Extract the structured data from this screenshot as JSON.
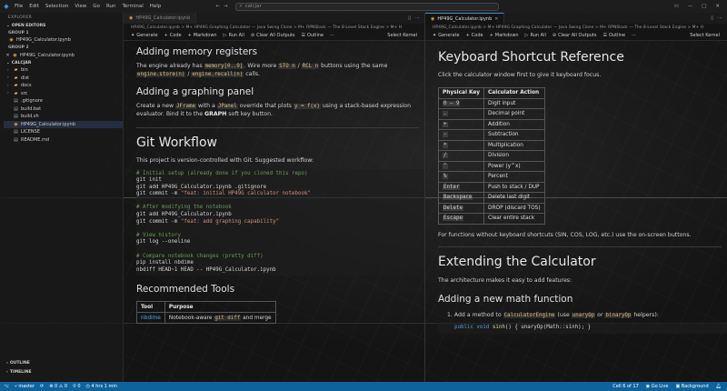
{
  "titlebar": {
    "menu": [
      "File",
      "Edit",
      "Selection",
      "View",
      "Go",
      "Run",
      "Terminal",
      "Help"
    ],
    "search_placeholder": "calcjar"
  },
  "sidebar": {
    "title": "EXPLORER",
    "open_editors": "OPEN EDITORS",
    "group1": "GROUP 1",
    "group1_items": [
      {
        "label": "HP49G_Calculator.ipynb"
      }
    ],
    "group2": "GROUP 2",
    "group2_items": [
      {
        "label": "HP49G_Calculator.ipynb"
      }
    ],
    "project": "CALCJAR",
    "tree": [
      {
        "label": "bin",
        "type": "folder"
      },
      {
        "label": "dist",
        "type": "folder"
      },
      {
        "label": "docs",
        "type": "folder"
      },
      {
        "label": "src",
        "type": "folder"
      },
      {
        "label": ".gitignore",
        "type": "file"
      },
      {
        "label": "build.bat",
        "type": "file"
      },
      {
        "label": "build.sh",
        "type": "file"
      },
      {
        "label": "HP49G_Calculator.ipynb",
        "type": "notebook"
      },
      {
        "label": "LICENSE",
        "type": "file"
      },
      {
        "label": "README.md",
        "type": "file"
      }
    ],
    "outline": "OUTLINE",
    "timeline": "TIMELINE"
  },
  "left": {
    "tabs": [
      {
        "label": "HP49G_Calculator.ipynb",
        "state": "inactive"
      }
    ],
    "breadcrumb": "HP49G_Calculator.ipynb > M+ HP49G Graphing Calculator — Java Swing Clone > M+ RPNStack — The 8-Level Stack Engine > M+ H",
    "toolbar": {
      "generate": "Generate",
      "code": "Code",
      "markdown": "Markdown",
      "run_all": "Run All",
      "clear": "Clear All Outputs",
      "outline": "Outline",
      "kernel": "Select Kernel"
    },
    "mem_title": "Adding memory registers",
    "mem_p1a": "The engine already has ",
    "mem_code1": "memory[0..9]",
    "mem_p1b": ". Wire more ",
    "mem_code2": "STO n",
    "mem_p1c": " / ",
    "mem_code3": "RCL n",
    "mem_p1d": " buttons using the same",
    "mem_code4": "engine.store(n)",
    "mem_p1e": " / ",
    "mem_code5": "engine.recall(n)",
    "mem_p1f": " calls.",
    "graph_title": "Adding a graphing panel",
    "graph_p1a": "Create a new ",
    "graph_code1": "JFrame",
    "graph_p1b": " with a ",
    "graph_code2": "JPanel",
    "graph_p1c": " override that plots ",
    "graph_code3": "y = f(x)",
    "graph_p1d": " using a stack-based expression",
    "graph_p2a": "evaluator. Bind it to the ",
    "graph_bold": "GRAPH",
    "graph_p2b": " soft key button.",
    "git_title": "Git Workflow",
    "git_intro": "This project is version-controlled with Git. Suggested workflow:",
    "code_lines": [
      {
        "cls": "cm",
        "text": "# Initial setup (already done if you cloned this repo)"
      },
      {
        "cls": "",
        "text": "git init"
      },
      {
        "cls": "",
        "text": "git add HP49G_Calculator.ipynb .gitignore"
      },
      {
        "cls": "mix",
        "pre": "git commit -m ",
        "str": "\"feat: initial HP49G calculator notebook\""
      },
      {
        "cls": "blank",
        "text": " "
      },
      {
        "cls": "cm",
        "text": "# After modifying the notebook"
      },
      {
        "cls": "",
        "text": "git add HP49G_Calculator.ipynb"
      },
      {
        "cls": "mix",
        "pre": "git commit -m ",
        "str": "\"feat: add graphing capability\""
      },
      {
        "cls": "blank",
        "text": " "
      },
      {
        "cls": "cm",
        "text": "# View history"
      },
      {
        "cls": "",
        "text": "git log --oneline"
      },
      {
        "cls": "blank",
        "text": " "
      },
      {
        "cls": "cm",
        "text": "# Compare notebook changes (pretty diff)"
      },
      {
        "cls": "",
        "text": "pip install nbdime"
      },
      {
        "cls": "",
        "text": "nbdiff HEAD~1 HEAD -- HP49G_Calculator.ipynb"
      }
    ],
    "tools_title": "Recommended Tools",
    "tools_head": [
      "Tool",
      "Purpose"
    ],
    "tools_rows": [
      {
        "tool": "nbdime",
        "purpose_a": "Notebook-aware ",
        "purpose_code": "git diff",
        "purpose_b": " and merge"
      }
    ]
  },
  "right": {
    "tabs": [
      {
        "label": "HP49G_Calculator.ipynb",
        "state": "active"
      }
    ],
    "breadcrumb": "HP49G_Calculator.ipynb > M+ HP49G Graphing Calculator — Java Swing Clone > M+ RPNStack — The 8-Level Stack Engine > M+ H",
    "toolbar": {
      "generate": "Generate",
      "code": "Code",
      "markdown": "Markdown",
      "run_all": "Run All",
      "clear": "Clear All Outputs",
      "outline": "Outline",
      "kernel": "Select Kernel"
    },
    "kb_title": "Keyboard Shortcut Reference",
    "kb_intro": "Click the calculator window first to give it keyboard focus.",
    "kb_head": [
      "Physical Key",
      "Calculator Action"
    ],
    "kb_rows": [
      {
        "key": "0 – 9",
        "action": "Digit input"
      },
      {
        "key": ".",
        "action": "Decimal point"
      },
      {
        "key": "+",
        "action": "Addition"
      },
      {
        "key": "-",
        "action": "Subtraction"
      },
      {
        "key": "*",
        "action": "Multiplication"
      },
      {
        "key": "/",
        "action": "Division"
      },
      {
        "key": "^",
        "action": "Power (y^x)"
      },
      {
        "key": "%",
        "action": "Percent"
      },
      {
        "key": "Enter",
        "action": "Push to stack / DUP"
      },
      {
        "key": "Backspace",
        "action": "Delete last digit"
      },
      {
        "key": "Delete",
        "action": "DROP (discard TOS)"
      },
      {
        "key": "Escape",
        "action": "Clear entire stack"
      }
    ],
    "kb_note": "For functions without keyboard shortcuts (SIN, COS, LOG, etc.) use the on-screen buttons.",
    "ext_title": "Extending the Calculator",
    "ext_intro": "The architecture makes it easy to add features:",
    "ext_sub": "Adding a new math function",
    "ext_li_a": "1. Add a method to ",
    "ext_li_code1": "CalculatorEngine",
    "ext_li_b": " (use ",
    "ext_li_code2": "unaryOp",
    "ext_li_c": " or ",
    "ext_li_code3": "binaryOp",
    "ext_li_d": " helpers):",
    "ext_code_kw": "public void ",
    "ext_code_fn": "sinh",
    "ext_code_rest": "() { unaryOp(Math::sinh); }"
  },
  "statusbar": {
    "remote": "⌥",
    "branch": "master",
    "sync": "⟳",
    "errors": "0",
    "warnings": "0",
    "ports": "0",
    "time": "4 hrs 1 min",
    "cell": "Cell 6 of 17",
    "golive": "Go Live",
    "bg": "Background"
  },
  "colors": {
    "accent": "#0e639c",
    "link": "#4fa3e8",
    "comment": "#6a9955",
    "string": "#ce9178",
    "inline_code": "#d7ba7d"
  }
}
